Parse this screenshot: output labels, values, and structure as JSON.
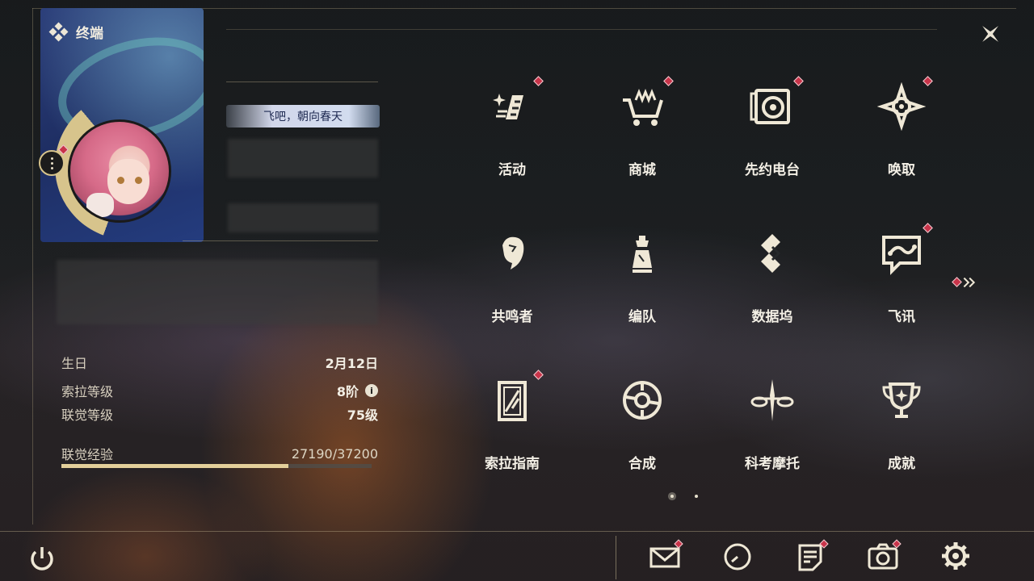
{
  "header": {
    "title": "终端",
    "close_icon": "close-icon"
  },
  "profile": {
    "signature": "飞吧，朝向春天",
    "more_icon": "more-icon"
  },
  "stats": {
    "birthday_label": "生日",
    "birthday_value": "2月12日",
    "sola_level_label": "索拉等级",
    "sola_level_value": "8阶",
    "union_level_label": "联觉等级",
    "union_level_value": "75级",
    "union_exp_label": "联觉经验",
    "union_exp_value": "27190/37200",
    "union_exp_progress": 0.7309
  },
  "menu": {
    "items": [
      {
        "label": "活动",
        "icon": "events-icon",
        "badge": true
      },
      {
        "label": "商城",
        "icon": "shop-cart-icon",
        "badge": true
      },
      {
        "label": "先约电台",
        "icon": "radio-icon",
        "badge": true
      },
      {
        "label": "唤取",
        "icon": "convene-icon",
        "badge": true
      },
      {
        "label": "共鸣者",
        "icon": "resonator-icon",
        "badge": false
      },
      {
        "label": "编队",
        "icon": "team-icon",
        "badge": false
      },
      {
        "label": "数据坞",
        "icon": "databank-icon",
        "badge": false
      },
      {
        "label": "飞讯",
        "icon": "chat-icon",
        "badge": true
      },
      {
        "label": "索拉指南",
        "icon": "guidebook-icon",
        "badge": true
      },
      {
        "label": "合成",
        "icon": "synthesis-icon",
        "badge": false
      },
      {
        "label": "科考摩托",
        "icon": "motorbike-icon",
        "badge": false
      },
      {
        "label": "成就",
        "icon": "achievement-trophy-icon",
        "badge": false
      }
    ],
    "page_count": 2,
    "current_page": 1
  },
  "bottom_bar": {
    "power_icon": "power-icon",
    "mail_icon": "mail-icon",
    "clock_icon": "clock-icon",
    "notes_icon": "notes-icon",
    "camera_icon": "camera-icon",
    "settings_icon": "gear-icon"
  },
  "colors": {
    "accent_gold": "#d7c48c",
    "badge_red": "#c8344a",
    "exp_fill": "#e3cf9a"
  }
}
